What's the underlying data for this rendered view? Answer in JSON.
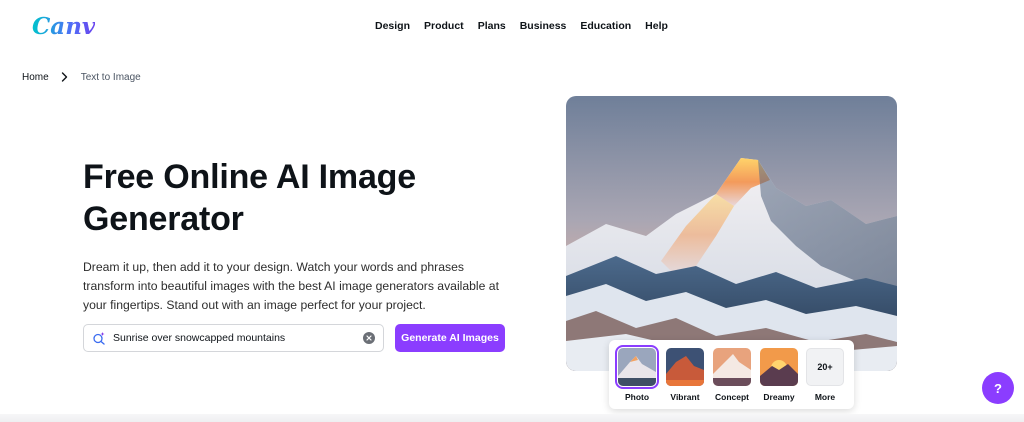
{
  "brand": {
    "logo_text": "Canva",
    "accent": "#8b3dff"
  },
  "nav": {
    "items": [
      {
        "label": "Design"
      },
      {
        "label": "Product"
      },
      {
        "label": "Plans"
      },
      {
        "label": "Business"
      },
      {
        "label": "Education"
      },
      {
        "label": "Help"
      }
    ]
  },
  "breadcrumb": {
    "home": "Home",
    "current": "Text to Image",
    "separator_icon": "chevron-right-icon"
  },
  "hero": {
    "title": "Free Online AI Image Generator",
    "description": "Dream it up, then add it to your design. Watch your words and phrases transform into beautiful images with the best AI image generators available at your fingertips. Stand out with an image perfect for your project."
  },
  "prompt": {
    "value": "Sunrise over snowcapped mountains",
    "icon": "magic-search-icon",
    "clear_icon": "clear-icon"
  },
  "generate_button": {
    "label": "Generate AI Images"
  },
  "styles": {
    "options": [
      {
        "label": "Photo",
        "selected": true
      },
      {
        "label": "Vibrant",
        "selected": false
      },
      {
        "label": "Concept",
        "selected": false
      },
      {
        "label": "Dreamy",
        "selected": false
      }
    ],
    "more": {
      "count": "20+",
      "label": "More"
    }
  },
  "help": {
    "label": "?"
  }
}
